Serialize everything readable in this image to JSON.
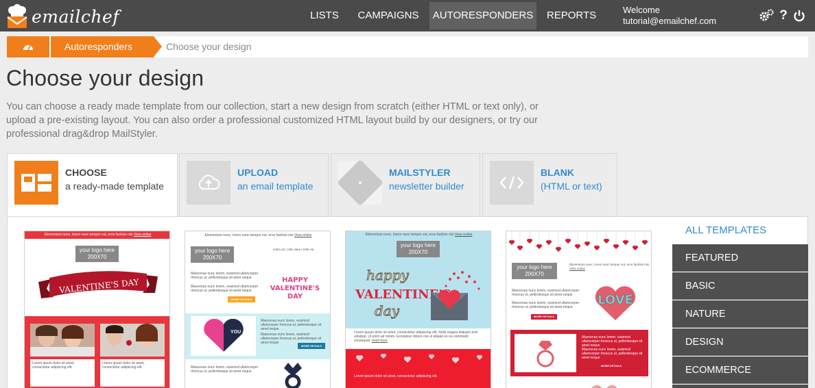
{
  "app": {
    "brand": "emailchef"
  },
  "nav": {
    "items": [
      "LISTS",
      "CAMPAIGNS",
      "AUTORESPONDERS",
      "REPORTS"
    ],
    "active": "AUTORESPONDERS"
  },
  "user": {
    "welcome": "Welcome",
    "email": "tutorial@emailchef.com"
  },
  "breadcrumb": {
    "section": "Autoresponders",
    "current": "Choose your design"
  },
  "page": {
    "title": "Choose your design",
    "intro": "You can choose a ready made template from our collection, start a new design from scratch (either HTML or text only), or upload a pre-existing layout. You can also order a professional customized HTML layout build by our designers, or try our professional drag&drop MailStyler."
  },
  "tabs": [
    {
      "title": "CHOOSE",
      "subtitle": "a ready-made template"
    },
    {
      "title": "UPLOAD",
      "subtitle": "an email template"
    },
    {
      "title": "MAILSTYLER",
      "subtitle": "newsletter builder"
    },
    {
      "title": "BLANK",
      "subtitle": "(HTML or text)"
    }
  ],
  "templates": {
    "header_text": "Elementum nunc, lorem nunc tempor vut, eros facilisis nisi",
    "view_online": "View online",
    "logo": "your logo here",
    "logo_size": "200X70",
    "t1_banner": "VALENTINE'S DAY",
    "t2_title": "HAPPY VALENTINE'S DAY",
    "t2_links": "mirim arc | dim viam | mihi via",
    "t2_heart": "YOU",
    "t2_text": "Maecenas nunc lorem, euismod ullamcorper rhoncus ut, pellentesque sit amet neque",
    "more": "MORE DETAILS",
    "t3_title1": "happy",
    "t3_title2": "VALENTINE'S",
    "t3_title3": "day",
    "t3_text": "Lorem ipsum dolor sit amet, consectetur adipiscing elit. Nulla magna aliquam erat volutpat. Ut enim ad minim. Excepteur dolore nisi ut aliquip ex ea commodo consequat.",
    "t3_read": "read more",
    "t4_love": "LOVE",
    "lorem": "Lorem ipsum dolor sit amet, consectetur adipiscing elit."
  },
  "sidebar": {
    "all": "ALL TEMPLATES",
    "categories": [
      "FEATURED",
      "BASIC",
      "NATURE",
      "DESIGN",
      "ECOMMERCE"
    ]
  },
  "colors": {
    "topbar": "#4a4a4a",
    "accent": "#f07f1b",
    "link": "#2f8bd1",
    "sidebar": "#4f4f4f"
  }
}
